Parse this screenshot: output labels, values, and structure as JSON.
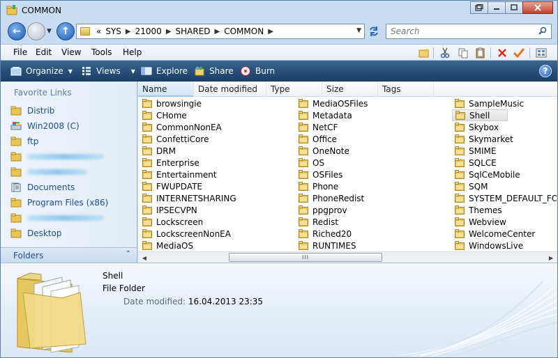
{
  "window": {
    "title": "COMMON",
    "caption_buttons": [
      "restore",
      "minimize",
      "maximize",
      "close"
    ]
  },
  "address": {
    "overflow": "«",
    "crumbs": [
      "SYS",
      "21000",
      "SHARED",
      "COMMON"
    ]
  },
  "search": {
    "placeholder": "Search"
  },
  "menu": [
    {
      "label": "File"
    },
    {
      "label": "Edit"
    },
    {
      "label": "View"
    },
    {
      "label": "Tools"
    },
    {
      "label": "Help"
    }
  ],
  "commands": {
    "organize": "Organize",
    "views": "Views",
    "explore": "Explore",
    "share": "Share",
    "burn": "Burn"
  },
  "navpane": {
    "title": "Favorite Links",
    "items": [
      {
        "label": "Distrib",
        "icon": "folder-icon",
        "redacted": false
      },
      {
        "label": "Win2008 (C)",
        "icon": "network-drive-icon",
        "redacted": false
      },
      {
        "label": "ftp",
        "icon": "folder-icon",
        "redacted": false
      },
      {
        "label": "",
        "icon": "folder-icon",
        "redacted": true
      },
      {
        "label": "",
        "icon": "folder-icon",
        "redacted": true
      },
      {
        "label": "Documents",
        "icon": "documents-icon",
        "redacted": false
      },
      {
        "label": "Program Files (x86)",
        "icon": "folder-icon",
        "redacted": false
      },
      {
        "label": "",
        "icon": "folder-icon",
        "redacted": true
      },
      {
        "label": "Desktop",
        "icon": "folder-icon",
        "redacted": false
      }
    ],
    "folders_label": "Folders"
  },
  "columns": [
    "Name",
    "Date modified",
    "Type",
    "Size",
    "Tags"
  ],
  "files": {
    "col1": [
      "browsingie",
      "CHome",
      "CommonNonEA",
      "ConfettiCore",
      "DRM",
      "Enterprise",
      "Entertainment",
      "FWUPDATE",
      "INTERNETSHARING",
      "IPSECVPN",
      "Lockscreen",
      "LockscreenNonEA",
      "MediaOS"
    ],
    "col2": [
      "MediaOSFiles",
      "Metadata",
      "NetCF",
      "Office",
      "OneNote",
      "OS",
      "OSFiles",
      "Phone",
      "PhoneRedist",
      "ppgprov",
      "Redist",
      "Riched20",
      "RUNTIMES"
    ],
    "col3": [
      "SampleMusic",
      "Shell",
      "Skybox",
      "Skymarket",
      "SMIME",
      "SQLCE",
      "SqlCeMobile",
      "SQM",
      "SYSTEM_DEFAULT_FO",
      "Themes",
      "Webview",
      "WelcomeCenter",
      "WindowsLive"
    ],
    "selected": "Shell"
  },
  "scrollbar": {
    "grip": "III"
  },
  "details": {
    "name": "Shell",
    "type": "File Folder",
    "modified_label": "Date modified:",
    "modified_value": "16.04.2013 23:35"
  },
  "colors": {
    "command_bar": "#264e78",
    "link_text": "#1a4f9c",
    "folder": "#e2c15a"
  }
}
